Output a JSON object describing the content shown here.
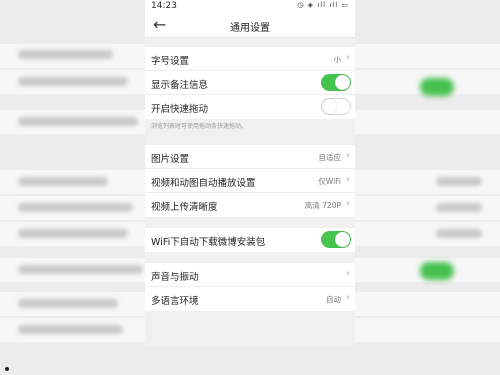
{
  "status_bar": {
    "time": "14:23",
    "icons": "◷ ◈ ıll ıll ▭"
  },
  "header": {
    "title": "通用设置",
    "back_icon": "back-arrow-icon"
  },
  "groups": [
    {
      "rows": [
        {
          "label": "字号设置",
          "value": "小",
          "type": "link"
        },
        {
          "label": "显示备注信息",
          "type": "toggle",
          "on": true
        },
        {
          "label": "开启快速拖动",
          "type": "toggle",
          "on": false
        }
      ],
      "hint": "浏览列表时可使用拖动条快速拖动。"
    },
    {
      "rows": [
        {
          "label": "图片设置",
          "value": "自适应",
          "type": "link"
        },
        {
          "label": "视频和动图自动播放设置",
          "value": "仅WiFi",
          "type": "link"
        },
        {
          "label": "视频上传清晰度",
          "value": "高清 720P",
          "type": "link"
        }
      ]
    },
    {
      "rows": [
        {
          "label": "WiFi下自动下载微博安装包",
          "type": "toggle",
          "on": true
        }
      ]
    },
    {
      "rows": [
        {
          "label": "声音与振动",
          "value": "",
          "type": "link"
        },
        {
          "label": "多语言环境",
          "value": "自动",
          "type": "link"
        }
      ]
    }
  ],
  "colors": {
    "toggle_on": "#45c44f",
    "background": "#f0f0f0"
  }
}
